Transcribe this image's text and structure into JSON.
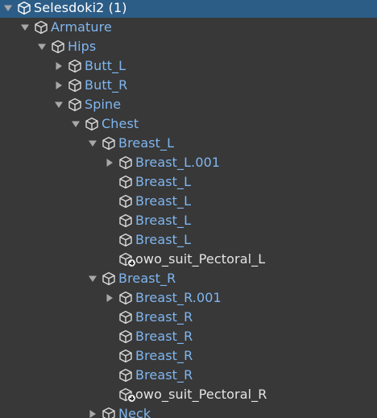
{
  "hierarchy": {
    "items": [
      {
        "name": "Selesdoki2 (1)",
        "depth": 0,
        "fold": "expanded",
        "selected": true,
        "prefab_added": false,
        "color": "white"
      },
      {
        "name": "Armature",
        "depth": 1,
        "fold": "expanded",
        "selected": false,
        "prefab_added": false,
        "color": "blue"
      },
      {
        "name": "Hips",
        "depth": 2,
        "fold": "expanded",
        "selected": false,
        "prefab_added": false,
        "color": "blue"
      },
      {
        "name": "Butt_L",
        "depth": 3,
        "fold": "collapsed",
        "selected": false,
        "prefab_added": false,
        "color": "blue"
      },
      {
        "name": "Butt_R",
        "depth": 3,
        "fold": "collapsed",
        "selected": false,
        "prefab_added": false,
        "color": "blue"
      },
      {
        "name": "Spine",
        "depth": 3,
        "fold": "expanded",
        "selected": false,
        "prefab_added": false,
        "color": "blue"
      },
      {
        "name": "Chest",
        "depth": 4,
        "fold": "expanded",
        "selected": false,
        "prefab_added": false,
        "color": "blue"
      },
      {
        "name": "Breast_L",
        "depth": 5,
        "fold": "expanded",
        "selected": false,
        "prefab_added": false,
        "color": "blue"
      },
      {
        "name": "Breast_L.001",
        "depth": 6,
        "fold": "collapsed",
        "selected": false,
        "prefab_added": false,
        "color": "blue"
      },
      {
        "name": "Breast_L",
        "depth": 6,
        "fold": "none",
        "selected": false,
        "prefab_added": false,
        "color": "blue"
      },
      {
        "name": "Breast_L",
        "depth": 6,
        "fold": "none",
        "selected": false,
        "prefab_added": false,
        "color": "blue"
      },
      {
        "name": "Breast_L",
        "depth": 6,
        "fold": "none",
        "selected": false,
        "prefab_added": false,
        "color": "blue"
      },
      {
        "name": "Breast_L",
        "depth": 6,
        "fold": "none",
        "selected": false,
        "prefab_added": false,
        "color": "blue"
      },
      {
        "name": "owo_suit_Pectoral_L",
        "depth": 6,
        "fold": "none",
        "selected": false,
        "prefab_added": true,
        "color": "white"
      },
      {
        "name": "Breast_R",
        "depth": 5,
        "fold": "expanded",
        "selected": false,
        "prefab_added": false,
        "color": "blue"
      },
      {
        "name": "Breast_R.001",
        "depth": 6,
        "fold": "collapsed",
        "selected": false,
        "prefab_added": false,
        "color": "blue"
      },
      {
        "name": "Breast_R",
        "depth": 6,
        "fold": "none",
        "selected": false,
        "prefab_added": false,
        "color": "blue"
      },
      {
        "name": "Breast_R",
        "depth": 6,
        "fold": "none",
        "selected": false,
        "prefab_added": false,
        "color": "blue"
      },
      {
        "name": "Breast_R",
        "depth": 6,
        "fold": "none",
        "selected": false,
        "prefab_added": false,
        "color": "blue"
      },
      {
        "name": "Breast_R",
        "depth": 6,
        "fold": "none",
        "selected": false,
        "prefab_added": false,
        "color": "blue"
      },
      {
        "name": "owo_suit_Pectoral_R",
        "depth": 6,
        "fold": "none",
        "selected": false,
        "prefab_added": true,
        "color": "white"
      },
      {
        "name": "Neck",
        "depth": 5,
        "fold": "collapsed",
        "selected": false,
        "prefab_added": false,
        "color": "blue"
      }
    ]
  },
  "icons": {
    "gameobject": "cube-icon",
    "expanded": "triangle-down-icon",
    "collapsed": "triangle-right-icon",
    "added": "plus-badge-icon"
  },
  "colors": {
    "background": "#383838",
    "selection": "#2c5d87",
    "prefab_text": "#7fb6f0",
    "plain_text": "#e4e4e4",
    "arrow": "#a8a8a8"
  }
}
